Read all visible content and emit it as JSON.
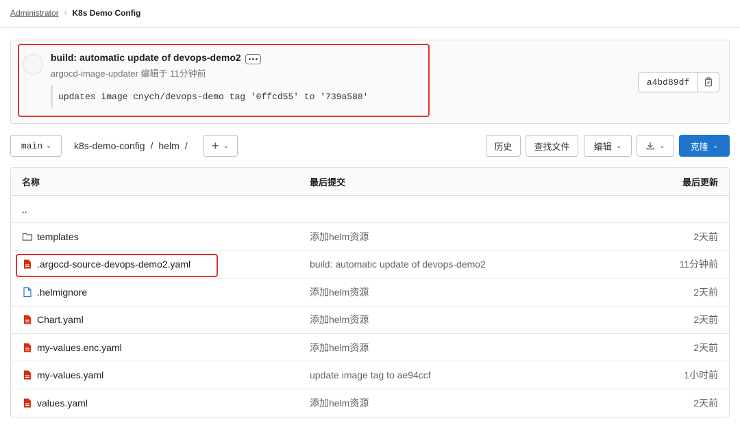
{
  "breadcrumb": {
    "parent": "Administrator",
    "current": "K8s Demo Config"
  },
  "commit": {
    "title": "build: automatic update of devops-demo2",
    "meta": "argocd-image-updater 编辑于 11分钟前",
    "description": "updates image cnych/devops-demo tag '0ffcd55' to '739a588'",
    "sha": "a4bd89df"
  },
  "toolbar": {
    "branch": "main",
    "path": {
      "repo": "k8s-demo-config",
      "sep": "/",
      "dir": "helm"
    },
    "history_label": "历史",
    "find_file_label": "查找文件",
    "edit_label": "编辑",
    "clone_label": "克隆"
  },
  "table": {
    "headers": {
      "name": "名称",
      "last_commit": "最后提交",
      "last_update": "最后更新"
    },
    "rows": [
      {
        "name": "..",
        "icon": "none",
        "commit": "",
        "time": ""
      },
      {
        "name": "templates",
        "icon": "folder-icon",
        "commit": "添加helm资源",
        "time": "2天前"
      },
      {
        "name": ".argocd-source-devops-demo2.yaml",
        "icon": "yaml-file-icon",
        "commit": "build: automatic update of devops-demo2",
        "time": "11分钟前"
      },
      {
        "name": ".helmignore",
        "icon": "file-icon",
        "commit": "添加helm资源",
        "time": "2天前"
      },
      {
        "name": "Chart.yaml",
        "icon": "yaml-file-icon",
        "commit": "添加helm资源",
        "time": "2天前"
      },
      {
        "name": "my-values.enc.yaml",
        "icon": "yaml-file-icon",
        "commit": "添加helm资源",
        "time": "2天前"
      },
      {
        "name": "my-values.yaml",
        "icon": "yaml-file-icon",
        "commit": "update image tag to ae94ccf",
        "time": "1小时前"
      },
      {
        "name": "values.yaml",
        "icon": "yaml-file-icon",
        "commit": "添加helm资源",
        "time": "2天前"
      }
    ]
  },
  "colors": {
    "accent": "#1f75cb",
    "highlight": "#e0342b",
    "yaml_icon": "#dd2b0e",
    "file_icon": "#1f75cb"
  }
}
